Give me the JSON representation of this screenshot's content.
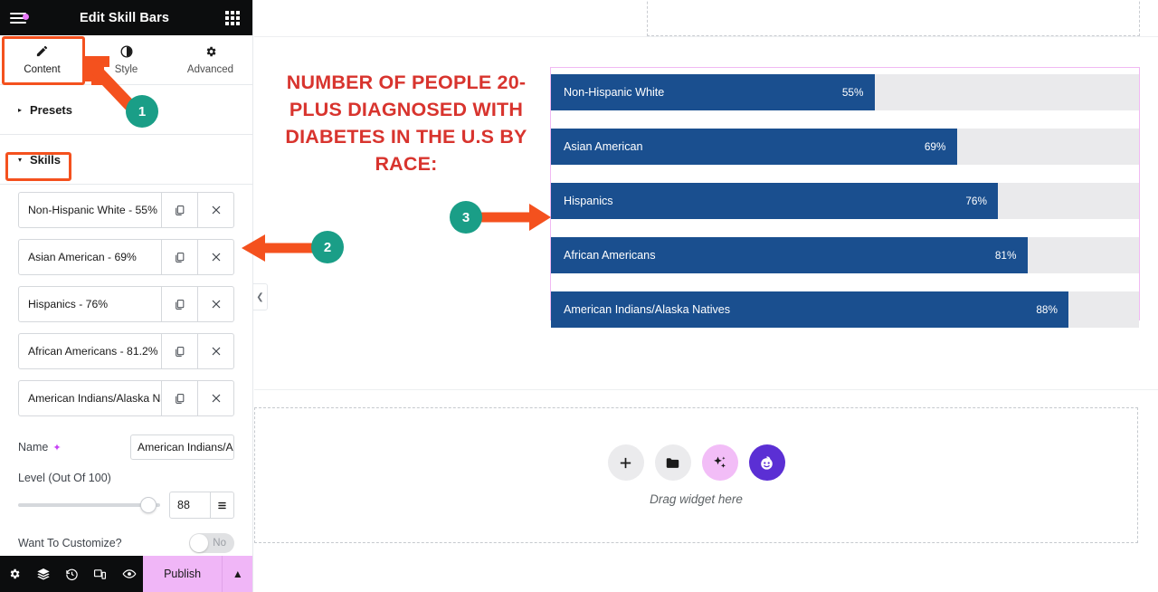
{
  "panel": {
    "title": "Edit Skill Bars",
    "menu_icon": "hamburger-icon",
    "apps_icon": "grid-apps-icon",
    "tabs": [
      {
        "label": "Content",
        "icon": "pencil-icon",
        "active": true
      },
      {
        "label": "Style",
        "icon": "contrast-half-circle-icon",
        "active": false
      },
      {
        "label": "Advanced",
        "icon": "gear-icon",
        "active": false
      }
    ],
    "sections": [
      {
        "label": "Presets",
        "expanded": false
      },
      {
        "label": "Skills",
        "expanded": true
      }
    ],
    "skills_repeater": [
      {
        "label": "Non-Hispanic White - 55%"
      },
      {
        "label": "Asian American - 69%"
      },
      {
        "label": "Hispanics - 76%"
      },
      {
        "label": "African Americans - 81.2%"
      },
      {
        "label": "American Indians/Alaska Na"
      }
    ],
    "repeater_buttons": {
      "duplicate_icon": "copy-icon",
      "remove_icon": "close-x-icon"
    },
    "fields": {
      "name_label": "Name",
      "name_ai_icon": "ai-sparkle-icon",
      "name_value": "American Indians/A",
      "level_label": "Level (Out Of 100)",
      "level_value": "88",
      "level_unit_icon": "units-stack-icon",
      "customize_label": "Want To Customize?",
      "customize_state": "No"
    },
    "footer": {
      "icons": [
        "settings-gear-icon",
        "layers-navigator-icon",
        "history-revisions-icon",
        "responsive-mode-icon",
        "preview-eye-icon"
      ],
      "publish_label": "Publish",
      "publish_arrow_icon": "chevron-up-icon"
    },
    "collapse_icon": "chevron-left-icon"
  },
  "canvas": {
    "headline": "Number of people 20-plus diagnosed with diabetes in the U.S by race:",
    "drop_zone": {
      "text": "Drag widget here",
      "icons": [
        {
          "name": "add-widget-plus-icon",
          "glyph": "+",
          "style": "gray"
        },
        {
          "name": "folder-templates-icon",
          "glyph": "█",
          "style": "gray"
        },
        {
          "name": "ai-sparkle-icon",
          "glyph": "✦",
          "style": "pink"
        },
        {
          "name": "elementor-ai-avatar-icon",
          "glyph": "☺",
          "style": "purple"
        }
      ]
    }
  },
  "chart_data": {
    "type": "bar",
    "title": "Number of people 20-plus diagnosed with diabetes in the U.S by race:",
    "orientation": "horizontal",
    "xlabel": "",
    "ylabel": "",
    "xlim": [
      0,
      100
    ],
    "grid": false,
    "legend": "none",
    "unit": "%",
    "categories": [
      "Non-Hispanic White",
      "Asian American",
      "Hispanics",
      "African Americans",
      "American Indians/Alaska Natives"
    ],
    "values": [
      55,
      69,
      76,
      81,
      88
    ],
    "labels": [
      "55%",
      "69%",
      "76%",
      "81%",
      "88%"
    ],
    "bar_color": "#1a4f8f",
    "track_color": "#eaeaec",
    "container_border_color": "#f1b9f3",
    "title_color": "#d8342e"
  },
  "annotations": {
    "markers": [
      {
        "id": "1",
        "target": "Content tab"
      },
      {
        "id": "2",
        "target": "Skills repeater list"
      },
      {
        "id": "3",
        "target": "Skill bars preview"
      }
    ],
    "marker_color": "#1a9e87",
    "arrow_color": "#f4511e",
    "highlight_color": "#f4511e"
  }
}
